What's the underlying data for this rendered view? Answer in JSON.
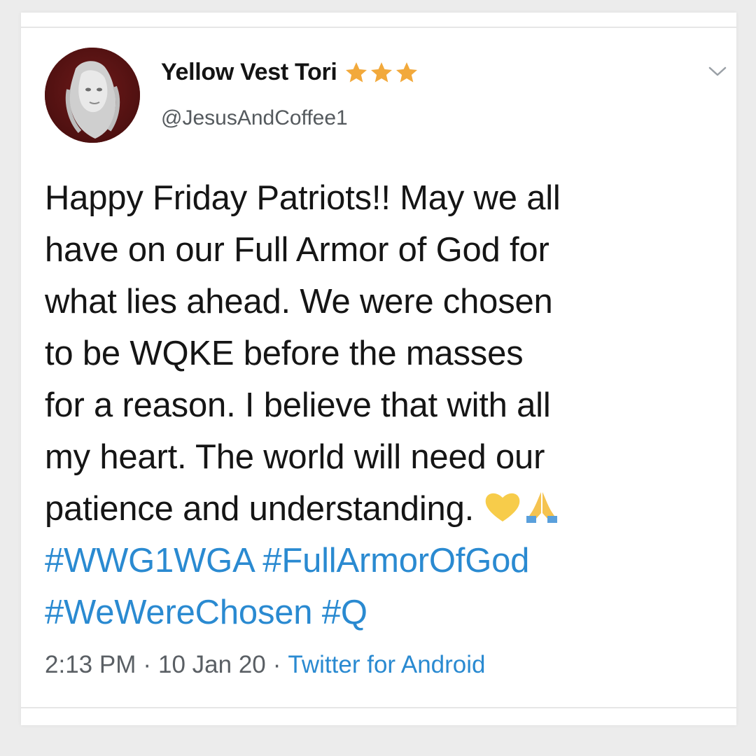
{
  "tweet": {
    "display_name": "Yellow Vest Tori",
    "badge_icon": "star-icon",
    "badge_count": 3,
    "badge_color": "#f2a93b",
    "handle": "@JesusAndCoffee1",
    "menu_icon": "chevron-down-icon",
    "lines": [
      "Happy Friday Patriots!! May we all",
      "have on our Full Armor of God for",
      "what lies ahead.  We were chosen",
      "to be WQKE before the masses",
      "for a reason. I believe that with all",
      "my heart. The world will need our",
      "patience and understanding."
    ],
    "emojis": [
      "yellow-heart-icon",
      "praying-hands-icon"
    ],
    "hashtag_lines": [
      [
        "#WWG1WGA",
        "#FullArmorOfGod"
      ],
      [
        "#WeWereChosen",
        "#Q"
      ]
    ],
    "time": "2:13 PM",
    "date": "10 Jan 20",
    "separator": "·",
    "source": "Twitter for Android",
    "link_color": "#2a8ad1"
  }
}
